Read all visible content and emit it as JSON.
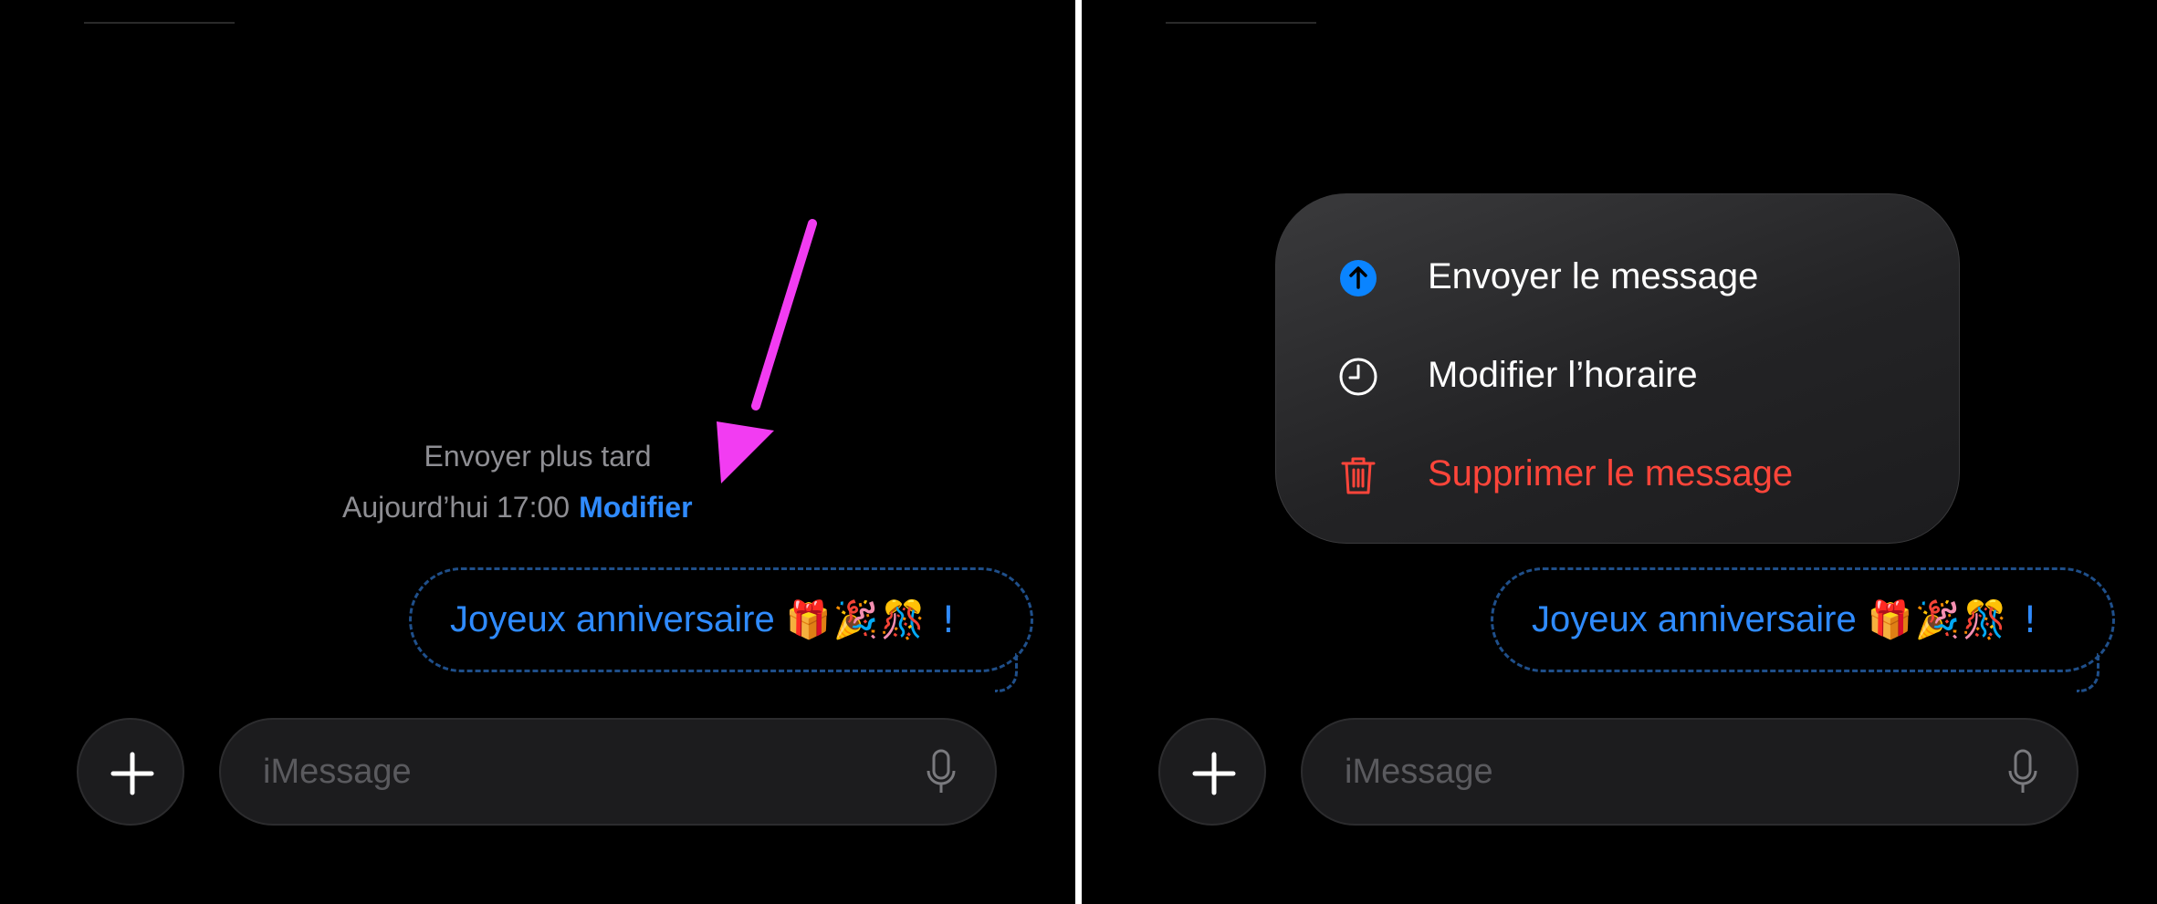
{
  "left_panel": {
    "schedule": {
      "title": "Envoyer plus tard",
      "time": "Aujourd’hui 17:00",
      "edit_link": "Modifier"
    },
    "message": {
      "text": "Joyeux anniversaire",
      "emojis": "🎁🎉🎊 !"
    },
    "composer": {
      "placeholder": "iMessage"
    },
    "annotation_color": "#f23cf2"
  },
  "right_panel": {
    "context_menu": {
      "items": [
        {
          "label": "Envoyer le message",
          "icon": "send-up-arrow-icon"
        },
        {
          "label": "Modifier l’horaire",
          "icon": "clock-icon"
        },
        {
          "label": "Supprimer le message",
          "icon": "trash-icon",
          "color": "#ff453a"
        }
      ]
    },
    "message": {
      "text": "Joyeux anniversaire",
      "emojis": "🎁🎉🎊 !"
    },
    "composer": {
      "placeholder": "iMessage"
    }
  },
  "colors": {
    "background": "#000000",
    "accent_blue": "#2f8bff",
    "danger_red": "#ff453a"
  }
}
